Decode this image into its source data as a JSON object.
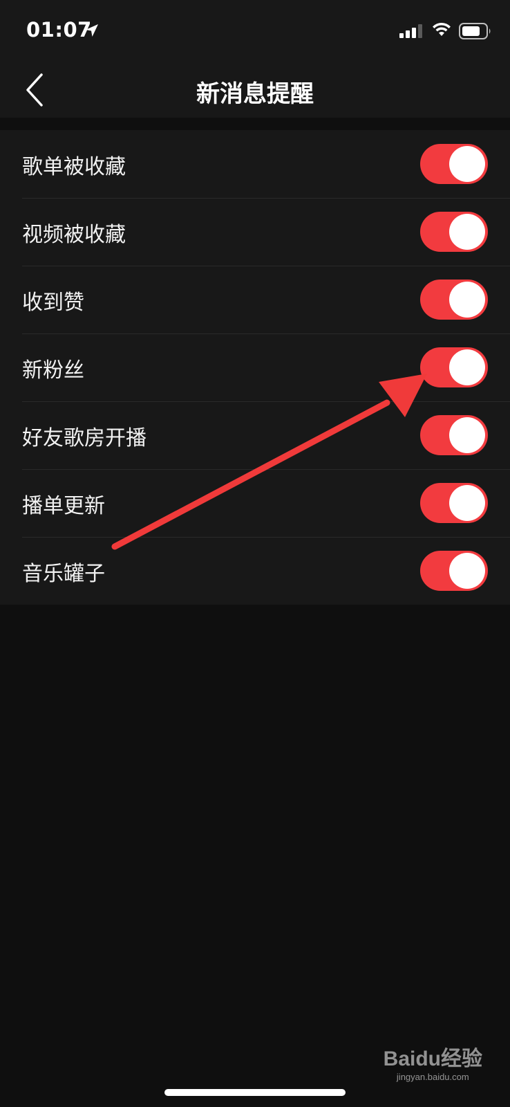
{
  "status_bar": {
    "time": "01:07",
    "icons": [
      "location-arrow-icon",
      "cellular-signal-icon",
      "wifi-icon",
      "battery-icon"
    ]
  },
  "header": {
    "title": "新消息提醒",
    "back_icon": "chevron-left-icon"
  },
  "settings": [
    {
      "label": "歌单被收藏",
      "enabled": true
    },
    {
      "label": "视频被收藏",
      "enabled": true
    },
    {
      "label": "收到赞",
      "enabled": true
    },
    {
      "label": "新粉丝",
      "enabled": true
    },
    {
      "label": "好友歌房开播",
      "enabled": true
    },
    {
      "label": "播单更新",
      "enabled": true
    },
    {
      "label": "音乐罐子",
      "enabled": true
    }
  ],
  "colors": {
    "accent": "#f23b3f",
    "background": "#0f0f0f",
    "surface": "#181818",
    "annotation_arrow": "#f03a3a"
  },
  "watermark": {
    "logo": "Baidu经验",
    "url": "jingyan.baidu.com"
  }
}
